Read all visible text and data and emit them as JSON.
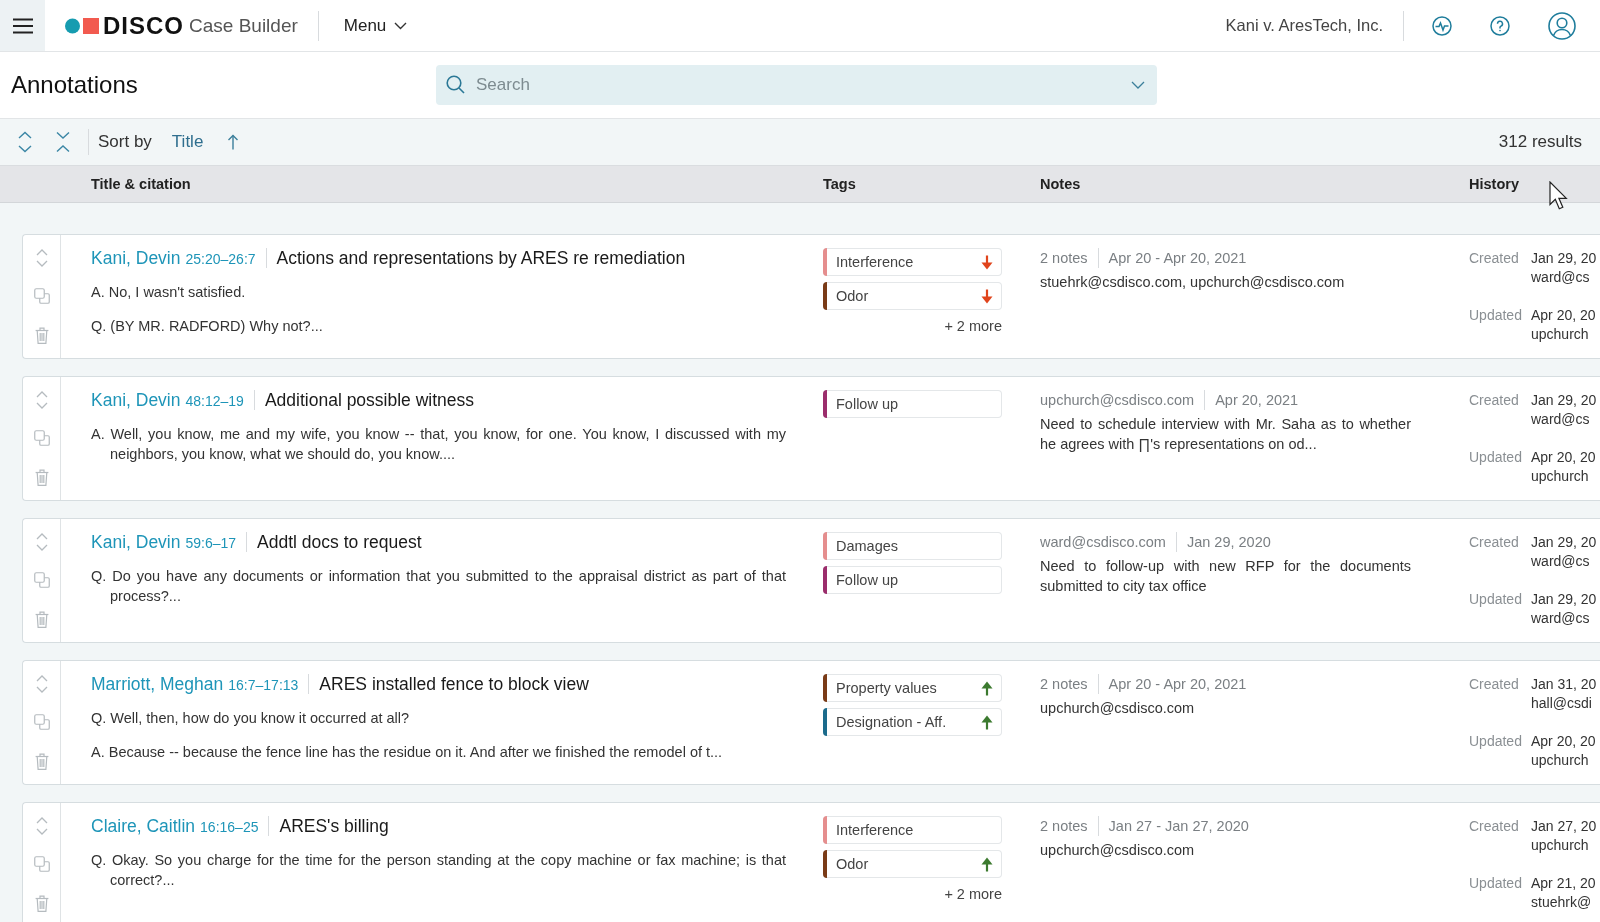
{
  "top_bar": {
    "brand": "DISCO",
    "product": "Case Builder",
    "menu": "Menu",
    "case_name": "Kani v. AresTech, Inc."
  },
  "page_header": {
    "title": "Annotations",
    "search": {
      "placeholder": "Search"
    }
  },
  "toolbar": {
    "sort_label": "Sort by",
    "sort_field": "Title",
    "sort_ascending": true,
    "results": "312 results"
  },
  "columns": [
    "Title & citation",
    "Tags",
    "Notes",
    "History"
  ],
  "annotations": [
    {
      "name": "Kani, Devin",
      "citation": "25:20–26:7",
      "title": "Actions and representations by ARES re remediation",
      "excerpt": [
        "A. No, I wasn't satisfied.",
        "Q. (BY MR. RADFORD) Why not?..."
      ],
      "tags": [
        {
          "label": "Interference",
          "color": "#e58e8e",
          "kind": "down"
        },
        {
          "label": "Odor",
          "color": "#7a3b17",
          "kind": "down"
        }
      ],
      "more_tags": "+ 2 more",
      "notes": {
        "summary": "2 notes",
        "date": "Apr 20 - Apr 20, 2021",
        "text": "stuehrk@csdisco.com, upchurch@csdisco.com"
      },
      "history": [
        {
          "label": "Created",
          "date": "Jan 29, 20",
          "user": "ward@cs"
        },
        {
          "label": "Updated",
          "date": "Apr 20, 20",
          "user": "upchurch"
        }
      ]
    },
    {
      "name": "Kani, Devin",
      "citation": "48:12–19",
      "title": "Additional possible witness",
      "excerpt": [
        "A. Well, you know, me and my wife, you know -- that, you know, for one. You know, I discussed with my neighbors, you know, what we should do, you know...."
      ],
      "tags": [
        {
          "label": "Follow up",
          "color": "#9b2d6c",
          "kind": "plain"
        }
      ],
      "notes": {
        "summary": "upchurch@csdisco.com",
        "date": "Apr 20, 2021",
        "text": "Need to schedule interview with Mr. Saha as to whether he agrees with ∏'s representations on od..."
      },
      "history": [
        {
          "label": "Created",
          "date": "Jan 29, 20",
          "user": "ward@cs"
        },
        {
          "label": "Updated",
          "date": "Apr 20, 20",
          "user": "upchurch"
        }
      ]
    },
    {
      "name": "Kani, Devin",
      "citation": "59:6–17",
      "title": "Addtl docs to request",
      "excerpt": [
        "Q. Do you have any documents or information that you submitted to the appraisal district as part of that process?..."
      ],
      "tags": [
        {
          "label": "Damages",
          "color": "#e58e8e",
          "kind": "plain"
        },
        {
          "label": "Follow up",
          "color": "#9b2d6c",
          "kind": "plain"
        }
      ],
      "notes": {
        "summary": "ward@csdisco.com",
        "date": "Jan 29, 2020",
        "text": "Need to follow-up with new RFP for the documents submitted to city tax office"
      },
      "history": [
        {
          "label": "Created",
          "date": "Jan 29, 20",
          "user": "ward@cs"
        },
        {
          "label": "Updated",
          "date": "Jan 29, 20",
          "user": "ward@cs"
        }
      ]
    },
    {
      "name": "Marriott, Meghan",
      "citation": "16:7–17:13",
      "title": "ARES installed fence to block view",
      "excerpt": [
        "Q. Well, then, how do you know it occurred at all?",
        "A. Because -- because the fence line has the residue on it. And after we finished the remodel of t..."
      ],
      "tags": [
        {
          "label": "Property values",
          "color": "#7a3b17",
          "kind": "up"
        },
        {
          "label": "Designation - Aff.",
          "color": "#1b6b8c",
          "kind": "up"
        }
      ],
      "notes": {
        "summary": "2 notes",
        "date": "Apr 20 - Apr 20, 2021",
        "text": "upchurch@csdisco.com"
      },
      "history": [
        {
          "label": "Created",
          "date": "Jan 31, 20",
          "user": "hall@csdi"
        },
        {
          "label": "Updated",
          "date": "Apr 20, 20",
          "user": "upchurch"
        }
      ]
    },
    {
      "name": "Claire, Caitlin",
      "citation": "16:16–25",
      "title": "ARES's billing",
      "excerpt": [
        "Q. Okay. So you charge for the time for the person standing at the copy machine or fax machine; is that correct?..."
      ],
      "tags": [
        {
          "label": "Interference",
          "color": "#e58e8e",
          "kind": "plain"
        },
        {
          "label": "Odor",
          "color": "#7a3b17",
          "kind": "up"
        }
      ],
      "more_tags": "+ 2 more",
      "notes": {
        "summary": "2 notes",
        "date": "Jan 27 - Jan 27, 2020",
        "text": "upchurch@csdisco.com"
      },
      "history": [
        {
          "label": "Created",
          "date": "Jan 27, 20",
          "user": "upchurch"
        },
        {
          "label": "Updated",
          "date": "Apr 21, 20",
          "user": "stuehrk@"
        }
      ]
    }
  ]
}
